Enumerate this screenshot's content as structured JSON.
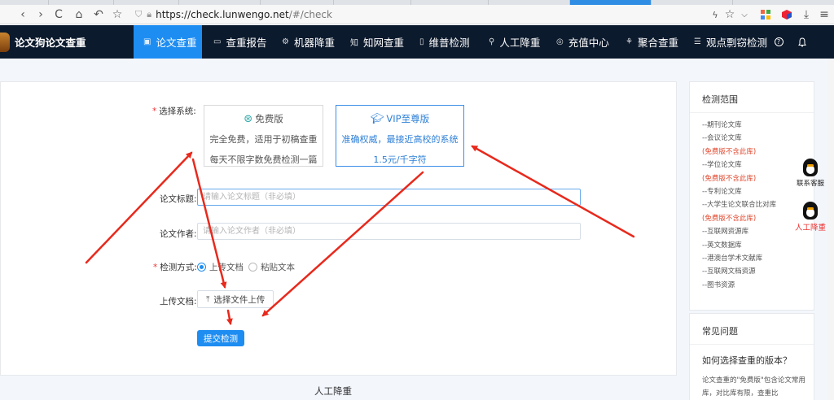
{
  "browser": {
    "url_main": "https://check.lunwengo.net",
    "url_rest": "/#/check",
    "nav_back": "‹",
    "nav_forward": "›",
    "nav_reload": "C",
    "nav_home": "⌂",
    "nav_undo": "↶",
    "nav_star": "☆"
  },
  "site": {
    "brand": "论文狗论文查重",
    "nav": [
      {
        "label": "论文查重",
        "icon": "▣"
      },
      {
        "label": "查重报告",
        "icon": "▭"
      },
      {
        "label": "机器降重",
        "icon": "⚙"
      },
      {
        "label": "知网查重",
        "icon": "知"
      },
      {
        "label": "维普检测",
        "icon": "▯"
      },
      {
        "label": "人工降重",
        "icon": "⚲"
      },
      {
        "label": "充值中心",
        "icon": "◎"
      },
      {
        "label": "聚合查重",
        "icon": "⚘"
      },
      {
        "label": "观点剽窃检测",
        "icon": "☰"
      }
    ],
    "help_icon": "?",
    "bell_icon": "🔔"
  },
  "form": {
    "system_label": "选择系统:",
    "free": {
      "title": "免费版",
      "line1": "完全免费，适用于初稿查重",
      "line2": "每天不限字数免费检测一篇"
    },
    "vip": {
      "title": "VIP至尊版",
      "line1": "准确权威，最接近高校的系统",
      "line2": "1.5元/千字符"
    },
    "title_label": "论文标题:",
    "title_placeholder": "请输入论文标题（非必填）",
    "author_label": "论文作者:",
    "author_placeholder": "请输入论文作者（非必填）",
    "method_label": "检测方式:",
    "method_upload": "上传文档",
    "method_paste": "粘贴文本",
    "upload_label": "上传文档:",
    "upload_button": "选择文件上传",
    "submit_button": "提交检测"
  },
  "bottom_title": "人工降重",
  "sidebar": {
    "scope_title": "检测范围",
    "scope_items": [
      {
        "text": "--期刊论文库",
        "warn": false
      },
      {
        "text": "--会议论文库",
        "warn": false
      },
      {
        "text": "(免费版不含此库)",
        "warn": true
      },
      {
        "text": "--学位论文库",
        "warn": false
      },
      {
        "text": "(免费版不含此库)",
        "warn": true
      },
      {
        "text": "--专利论文库",
        "warn": false
      },
      {
        "text": "--大学生论文联合比对库",
        "warn": false
      },
      {
        "text": "(免费版不含此库)",
        "warn": true
      },
      {
        "text": "--互联网资源库",
        "warn": false
      },
      {
        "text": "--英文数据库",
        "warn": false
      },
      {
        "text": "--港澳台学术文献库",
        "warn": false
      },
      {
        "text": "--互联网文档资源",
        "warn": false
      },
      {
        "text": "--图书资源",
        "warn": false
      }
    ],
    "faq_title": "常见问题",
    "faq_question": "如何选择查重的版本？",
    "faq_answer": "论文查重的\"免费版\"包含论文常用库，对比库有限，查重比"
  },
  "float": {
    "service": "联系客服",
    "manual": "人工降重"
  },
  "colors": {
    "accent": "#1e8df2",
    "nav_bg": "#0c1a2d",
    "warn": "#e0492f",
    "arrow": "#e8291c"
  }
}
